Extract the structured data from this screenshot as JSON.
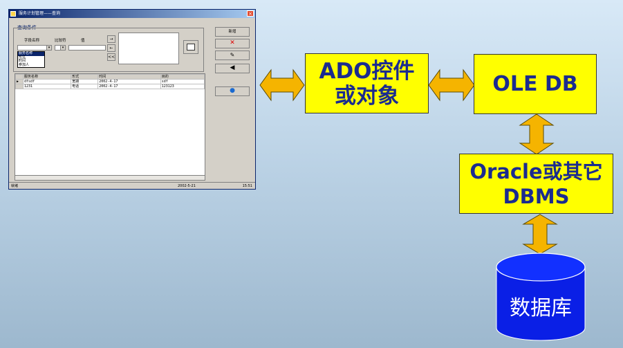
{
  "screenshot": {
    "window_title": "服务计划管理——查询",
    "close_glyph": "×",
    "query_group_title": "查询条件",
    "field_label": "字段名称",
    "compare_label": "比较符",
    "value_label": "值",
    "field_options": [
      "服务名称",
      "形式",
      "时间",
      "参加人"
    ],
    "selected_field_option": "服务名称",
    "small_buttons": [
      "→",
      "←",
      "<<"
    ],
    "side_buttons": [
      "新增",
      "删除",
      "修改",
      "刷新",
      "返回"
    ],
    "grid": {
      "columns": [
        "服务名称",
        "形式",
        "时间",
        "目的"
      ],
      "rows": [
        [
          "dfsdf",
          "宽期",
          "2002-4-17",
          "sdf"
        ],
        [
          "1231",
          "电话",
          "2002-4-17",
          "123123"
        ]
      ],
      "row_marker": "▶"
    },
    "status": {
      "left": "就绪",
      "date": "2002-5-21",
      "time": "15:51"
    }
  },
  "diagram": {
    "ado_box": [
      "ADO控件",
      "或对象"
    ],
    "oledb_box": "OLE DB",
    "oracle_box": [
      "Oracle或其它",
      "DBMS"
    ],
    "database_label": "数据库",
    "colors": {
      "box_fill": "#ffff00",
      "box_text": "#1b2b8f",
      "arrow_fill": "#f5b400",
      "cylinder_fill": "#0a1fe6"
    }
  }
}
